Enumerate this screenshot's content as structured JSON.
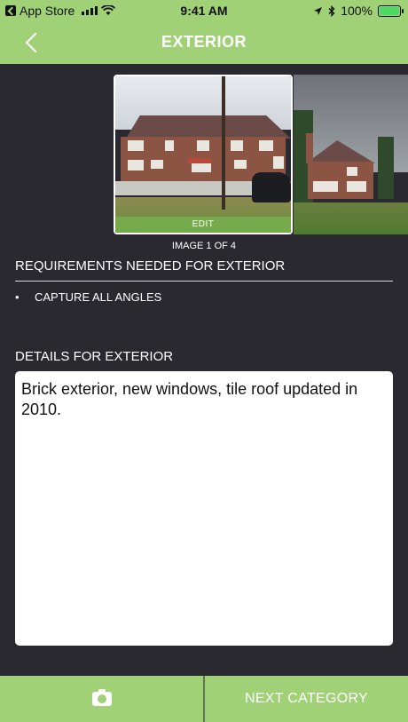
{
  "status_bar": {
    "back_app": "App Store",
    "time": "9:41 AM",
    "battery": "100%"
  },
  "nav": {
    "title": "EXTERIOR"
  },
  "gallery": {
    "edit_label": "EDIT",
    "counter": "IMAGE 1 OF 4"
  },
  "requirements": {
    "title": "REQUIREMENTS NEEDED FOR EXTERIOR",
    "items": [
      "CAPTURE ALL ANGLES"
    ]
  },
  "details": {
    "label": "DETAILS FOR EXTERIOR",
    "value": "Brick exterior, new windows, tile roof updated in 2010."
  },
  "footer": {
    "next_label": "NEXT CATEGORY"
  },
  "colors": {
    "accent_green": "#a0d177",
    "background": "#2b2930"
  }
}
